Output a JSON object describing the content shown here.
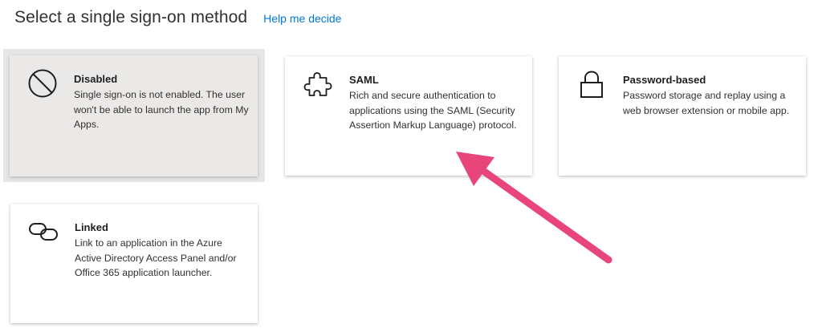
{
  "header": {
    "title": "Select a single sign-on method",
    "help_link": "Help me decide"
  },
  "cards": [
    {
      "title": "Disabled",
      "description": "Single sign-on is not enabled. The user won't be able to launch the app from My Apps.",
      "icon": "no-entry-icon",
      "selected": true
    },
    {
      "title": "SAML",
      "description": "Rich and secure authentication to applications using the SAML (Security Assertion Markup Language) protocol.",
      "icon": "puzzle-icon"
    },
    {
      "title": "Password-based",
      "description": "Password storage and replay using a web browser extension or mobile app.",
      "icon": "lock-icon"
    },
    {
      "title": "Linked",
      "description": "Link to an application in the Azure Active Directory Access Panel and/or Office 365 application launcher.",
      "icon": "link-icon"
    }
  ],
  "colors": {
    "link": "#0078d4",
    "selected_background": "#ebe9e7",
    "annotation_arrow": "#e8457a"
  },
  "annotation": {
    "type": "arrow",
    "points_to": "SAML"
  }
}
